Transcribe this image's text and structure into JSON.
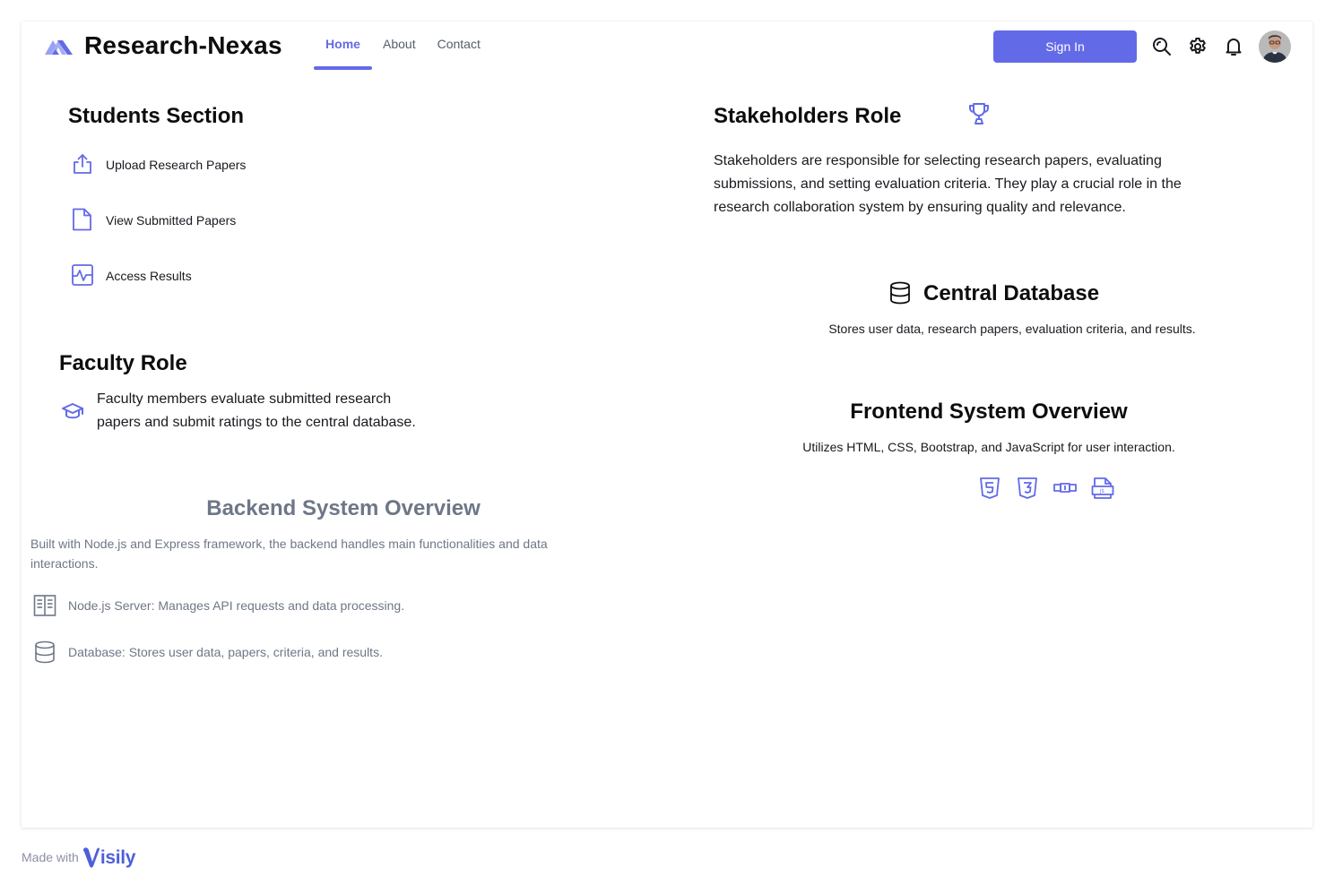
{
  "colors": {
    "accent": "#636ae8",
    "text": "#171a1f",
    "muted": "#6e7787"
  },
  "header": {
    "brand": "Research-Nexas",
    "nav": [
      {
        "label": "Home",
        "active": true
      },
      {
        "label": "About",
        "active": false
      },
      {
        "label": "Contact",
        "active": false
      }
    ],
    "sign_in_label": "Sign In",
    "icons": [
      "search-icon",
      "gear-icon",
      "bell-icon"
    ],
    "avatar_alt": "User avatar"
  },
  "students": {
    "title": "Students Section",
    "items": [
      {
        "icon": "upload-icon",
        "label": "Upload Research Papers"
      },
      {
        "icon": "file-icon",
        "label": "View Submitted Papers"
      },
      {
        "icon": "activity-icon",
        "label": "Access Results"
      }
    ]
  },
  "faculty": {
    "title": "Faculty Role",
    "icon": "graduation-cap-icon",
    "line1": "Faculty members evaluate submitted research",
    "line2": "papers and submit ratings to the central database."
  },
  "backend": {
    "title": "Backend System Overview",
    "description_line1": "Built with Node.js and Express framework, the backend handles main functionalities and data",
    "description_line2": "interactions.",
    "items": [
      {
        "icon": "server-book-icon",
        "label": "Node.js Server: Manages API requests and data processing."
      },
      {
        "icon": "database-icon",
        "label": "Database: Stores user data, papers, criteria, and results."
      }
    ]
  },
  "stakeholders": {
    "title": "Stakeholders Role",
    "icon": "trophy-icon",
    "line1": "Stakeholders are responsible for selecting research papers, evaluating",
    "line2": "submissions, and setting evaluation criteria. They play a crucial role in the",
    "line3": "research collaboration system by ensuring quality and relevance."
  },
  "central_db": {
    "title": "Central Database",
    "icon": "database-icon",
    "description": "Stores user data, research papers, evaluation criteria, and results."
  },
  "frontend": {
    "title": "Frontend System Overview",
    "description": "Utilizes HTML, CSS, Bootstrap, and JavaScript for user interaction.",
    "tech_icons": [
      "html5-icon",
      "css3-icon",
      "bootstrap-icon",
      "javascript-file-icon"
    ]
  },
  "footer": {
    "made_with": "Made with",
    "brand": "Visily"
  }
}
